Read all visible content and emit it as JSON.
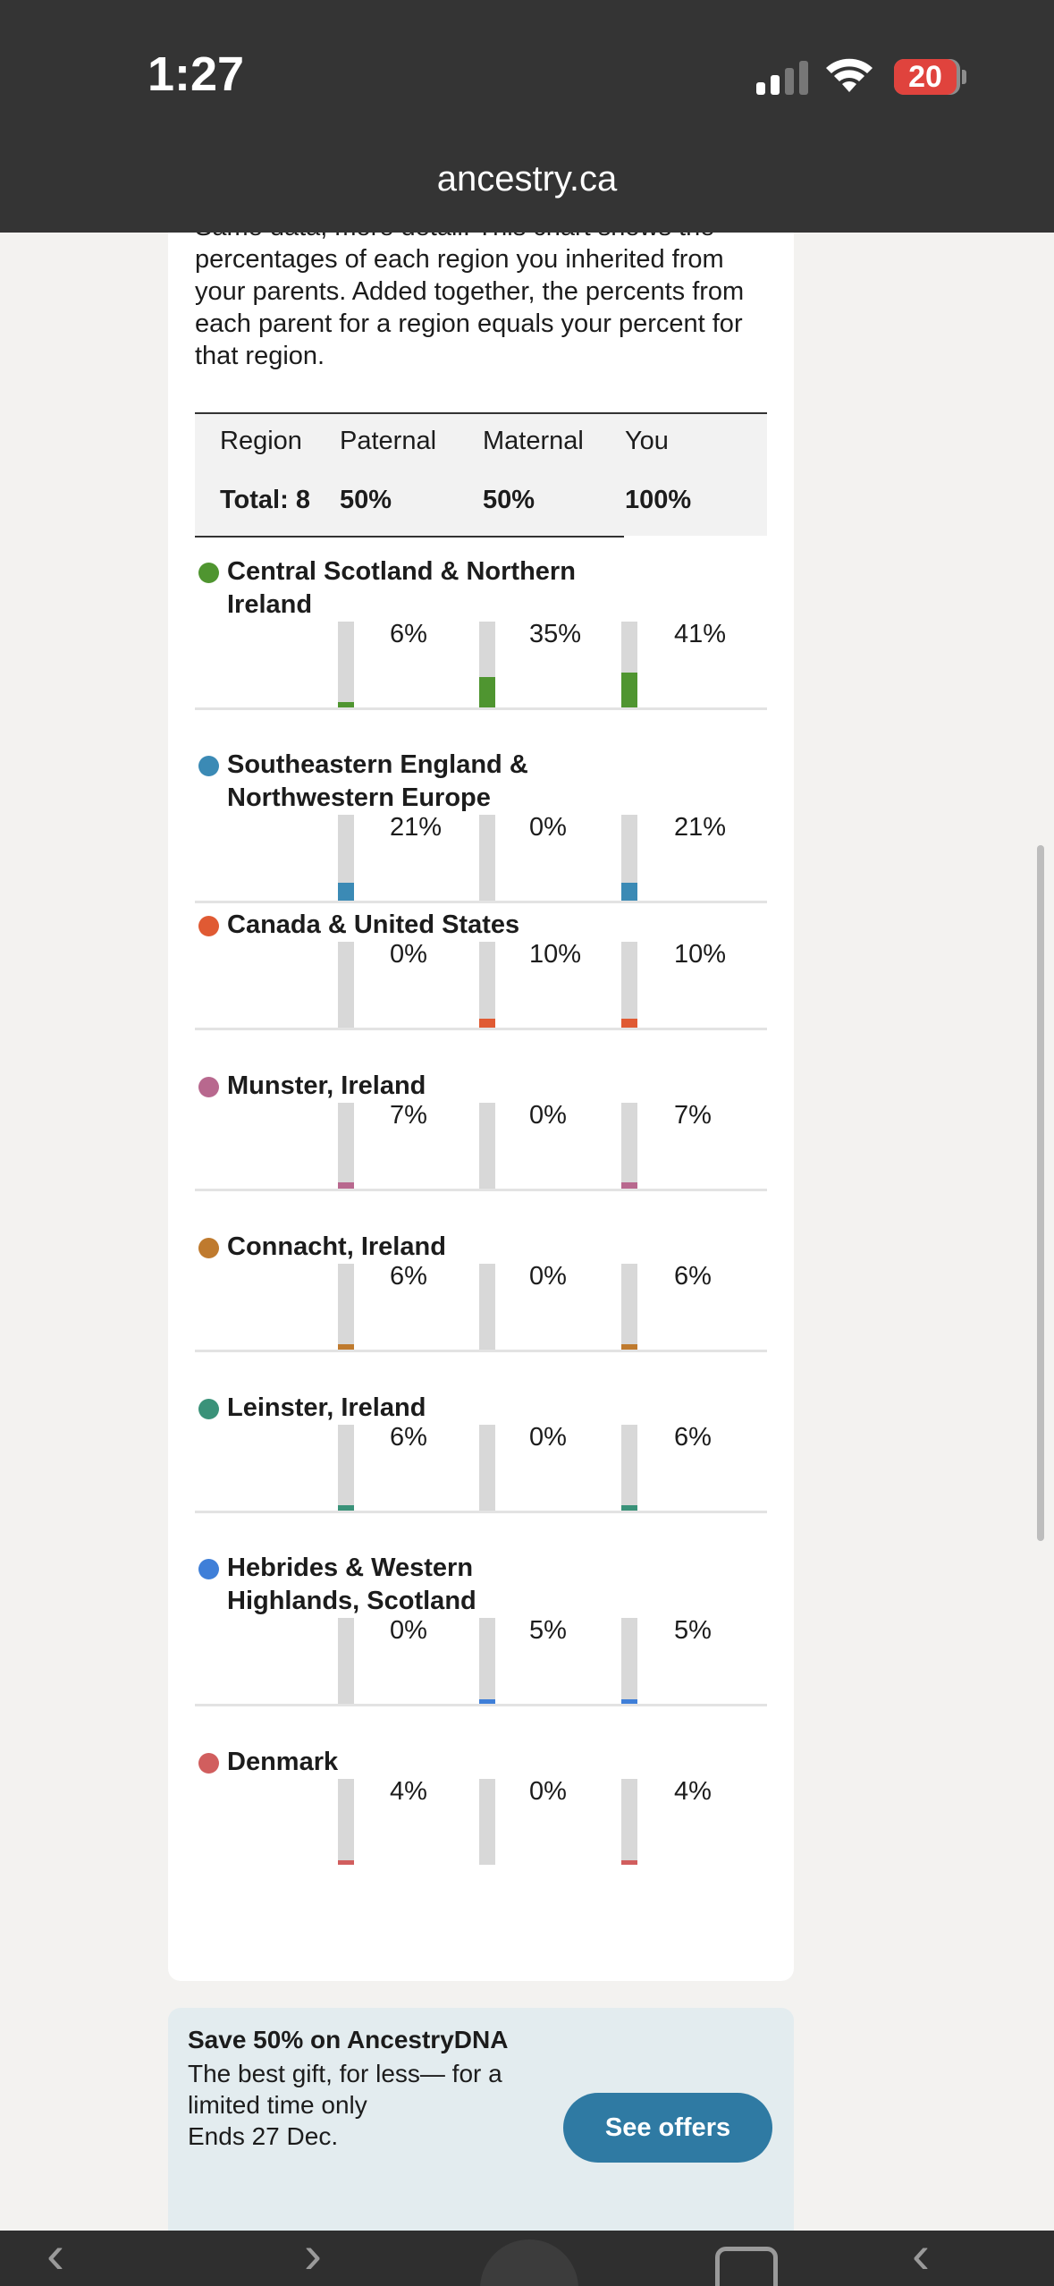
{
  "status": {
    "time": "1:27",
    "battery": "20"
  },
  "browser": {
    "url": "ancestry.ca"
  },
  "intro": {
    "text": "Same data, more detail. This chart shows the percentages of each region you inherited from your parents. Added together, the percents from each parent for a region equals your percent for that region."
  },
  "table": {
    "headers": [
      "Region",
      "Paternal",
      "Maternal",
      "You"
    ],
    "totals": [
      "Total: 8",
      "50%",
      "50%",
      "100%"
    ]
  },
  "regions": [
    {
      "name": "Central Scotland & Northern Ireland",
      "color": "#4f9530",
      "paternal": "6%",
      "maternal": "35%",
      "you": "41%"
    },
    {
      "name": "Southeastern England & Northwestern Europe",
      "color": "#3b8ab5",
      "paternal": "21%",
      "maternal": "0%",
      "you": "21%"
    },
    {
      "name": "Canada & United States",
      "color": "#e05a33",
      "paternal": "0%",
      "maternal": "10%",
      "you": "10%"
    },
    {
      "name": "Munster, Ireland",
      "color": "#b8688e",
      "paternal": "7%",
      "maternal": "0%",
      "you": "7%"
    },
    {
      "name": "Connacht, Ireland",
      "color": "#bf7a2e",
      "paternal": "6%",
      "maternal": "0%",
      "you": "6%"
    },
    {
      "name": "Leinster, Ireland",
      "color": "#3a9279",
      "paternal": "6%",
      "maternal": "0%",
      "you": "6%"
    },
    {
      "name": "Hebrides & Western Highlands, Scotland",
      "color": "#3f7fd8",
      "paternal": "0%",
      "maternal": "5%",
      "you": "5%"
    },
    {
      "name": "Denmark",
      "color": "#d15e5e",
      "paternal": "4%",
      "maternal": "0%",
      "you": "4%"
    }
  ],
  "promo": {
    "title": "Save 50% on AncestryDNA",
    "line1": "The best gift, for less— for a",
    "line2": "limited time only",
    "line3": "Ends 27 Dec.",
    "button": "See offers"
  }
}
